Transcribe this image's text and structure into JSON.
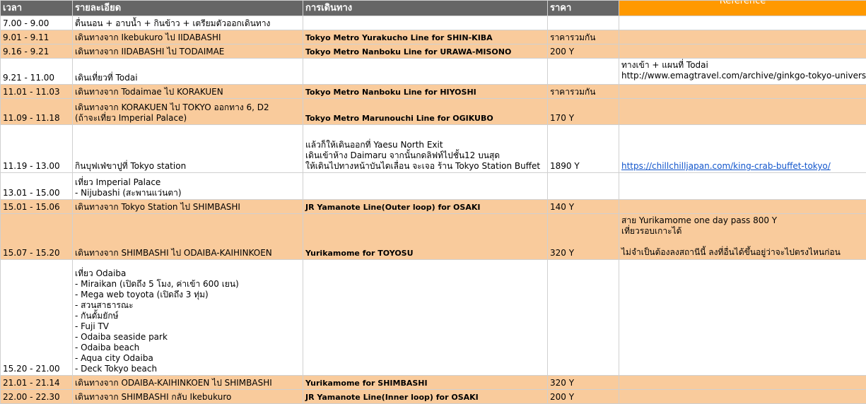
{
  "headers": {
    "time": "เวลา",
    "detail": "รายละเอียด",
    "route": "การเดินทาง",
    "price": "ราคา",
    "reference": "Reference"
  },
  "rows": [
    {
      "time": "7.00 - 9.00",
      "detail": [
        "ตื่นนอน + อาบน้ำ + กินข้าว + เตรียมตัวออกเดินทาง"
      ],
      "route": [],
      "price": "",
      "ref": []
    },
    {
      "time": "9.01 - 9.11",
      "detail": [
        "เดินทางจาก Ikebukuro ไป IIDABASHI"
      ],
      "route": [
        "Tokyo Metro Yurakucho Line for SHIN-KIBA"
      ],
      "price": "ราคารวมกัน",
      "ref": []
    },
    {
      "time": "9.16 - 9.21",
      "detail": [
        "เดินทางจาก IIDABASHI  ไป TODAIMAE"
      ],
      "route": [
        "Tokyo Metro Nanboku Line for URAWA-MISONO"
      ],
      "price": "200 Y",
      "ref": []
    },
    {
      "time": "9.21 - 11.00",
      "detail": [
        "เดินเที่ยวที่ Todai"
      ],
      "route": [],
      "price": "",
      "ref": [
        "ทางเข้า + แผนที่ Todai",
        "http://www.emagtravel.com/archive/ginkgo-tokyo-university.html"
      ]
    },
    {
      "time": "11.01 - 11.03",
      "detail": [
        "เดินทางจาก Todaimae ไป KORAKUEN"
      ],
      "route": [
        "Tokyo Metro Nanboku Line for HIYOSHI"
      ],
      "price": "ราคารวมกัน",
      "ref": []
    },
    {
      "time": "11.09 - 11.18",
      "detail": [
        "เดินทางจาก KORAKUEN  ไป TOKYO ออกทาง 6, D2",
        "(ถ้าจะเที่ยว Imperial Palace)"
      ],
      "route": [
        "Tokyo Metro Marunouchi Line for OGIKUBO"
      ],
      "price": "170 Y",
      "ref": []
    },
    {
      "time": "11.19 - 13.00",
      "detail": [
        "กินบุฟเฟ่ขาปูที่ Tokyo station"
      ],
      "route": [
        "แล้วก็ให้เดินออกที่ Yaesu North Exit",
        "เดินเข้าห้าง Daimaru จากนั้นกดลิฟท์ไปชั้น12 บนสุด",
        "ให้เดินไปทางหน้าบันไดเลื่อน จะเจอ ร้าน Tokyo Station Buffet"
      ],
      "price": "1890 Y",
      "ref": [
        "https://chillchilljapan.com/king-crab-buffet-tokyo/"
      ]
    },
    {
      "time": "13.01 - 15.00",
      "detail": [
        "เที่ยว Imperial Palace",
        "- Nijubashi (สะพานแว่นตา)"
      ],
      "route": [],
      "price": "",
      "ref": []
    },
    {
      "time": "15.01 - 15.06",
      "detail": [
        "เดินทางจาก Tokyo Station ไป SHIMBASHI"
      ],
      "route": [
        "JR Yamanote Line(Outer loop) for OSAKI"
      ],
      "price": "140 Y",
      "ref": []
    },
    {
      "time": "15.07 - 15.20",
      "detail": [
        "เดินทางจาก SHIMBASHI  ไป ODAIBA-KAIHINKOEN"
      ],
      "route": [
        "Yurikamome for TOYOSU"
      ],
      "price": "320 Y",
      "ref": [
        "สาย Yurikamome one day pass 800 Y",
        "เที่ยวรอบเกาะได้",
        "",
        "ไม่จำเป็นต้องลงสถานีนี้ ลงที่อื่นได้ขึ้นอยู่ว่าจะไปตรงไหนก่อน"
      ]
    },
    {
      "time": "15.20 - 21.00",
      "detail": [
        "เที่ยว Odaiba",
        "- Miraikan (เปิดถึง 5 โมง, ค่าเข้า 600 เยน)",
        "- Mega web toyota (เปิดถึง 3 ทุ่ม)",
        "- สวนสาธารณะ",
        "- กันดั้มยักษ์",
        "- Fuji TV",
        "- Odaiba seaside park",
        "- Odaiba beach",
        "- Aqua city Odaiba",
        "- Deck Tokyo beach"
      ],
      "route": [],
      "price": "",
      "ref": []
    },
    {
      "time": "21.01 - 21.14",
      "detail": [
        "เดินทางจาก ODAIBA-KAIHINKOEN ไป SHIMBASHI"
      ],
      "route": [
        "Yurikamome for SHIMBASHI"
      ],
      "price": "320 Y",
      "ref": []
    },
    {
      "time": "22.00 - 22.30",
      "detail": [
        "เดินทางจาก SHIMBASHI กลับ Ikebukuro"
      ],
      "route": [
        "JR Yamanote Line(Inner loop) for OSAKI"
      ],
      "price": "200 Y",
      "ref": []
    }
  ]
}
